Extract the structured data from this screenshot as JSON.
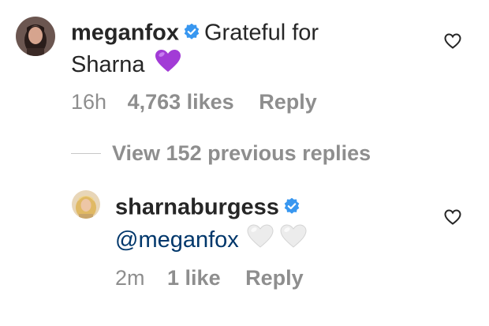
{
  "comment": {
    "username": "meganfox",
    "text_line1": "Grateful for",
    "text_line2": "Sharna",
    "text_emoji": "purple-heart",
    "time": "16h",
    "likes": "4,763 likes",
    "reply_label": "Reply"
  },
  "view_replies_label": "View 152 previous replies",
  "reply": {
    "username": "sharnaburgess",
    "mention": "@meganfox",
    "text_emoji": "white-heart white-heart",
    "time": "2m",
    "likes": "1 like",
    "reply_label": "Reply"
  },
  "colors": {
    "verified": "#3897f0",
    "muted": "#8e8e8e",
    "mention": "#00376b",
    "purple_heart": "#a23bd6",
    "white_heart": "#ececec"
  }
}
